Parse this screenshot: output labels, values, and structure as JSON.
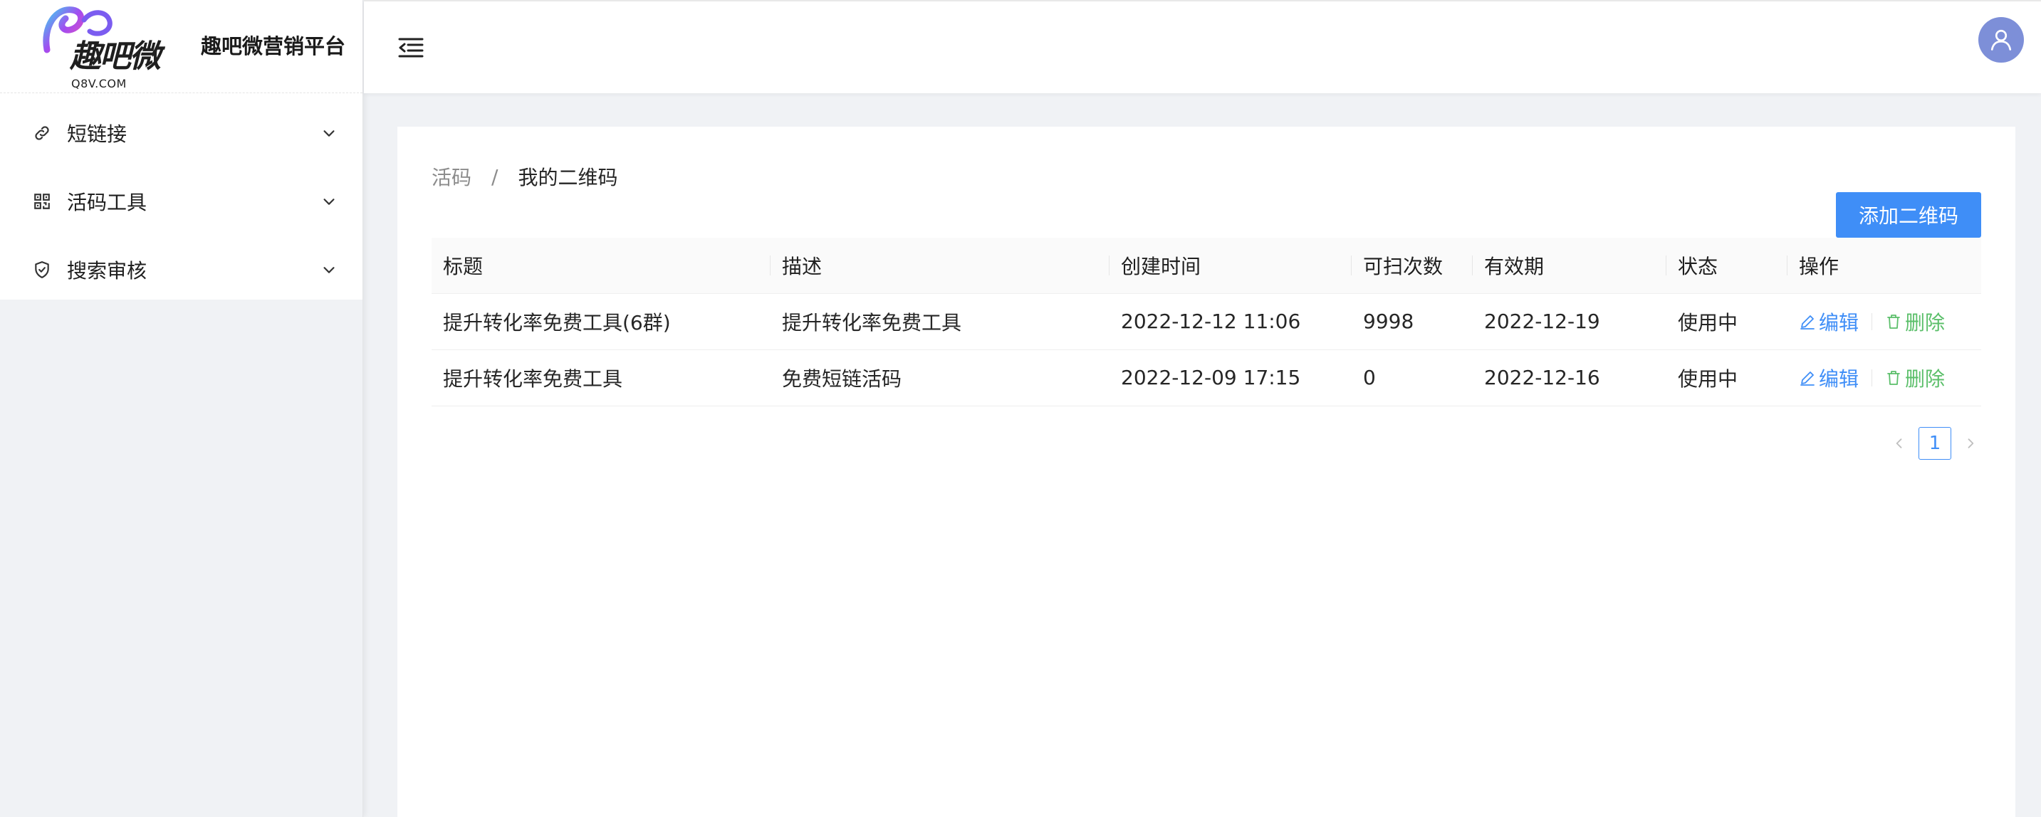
{
  "brand": {
    "logo_text": "趣吧微",
    "logo_sub": "Q8V.COM",
    "title": "趣吧微营销平台"
  },
  "sidebar": {
    "items": [
      {
        "label": "短链接",
        "icon": "link-icon"
      },
      {
        "label": "活码工具",
        "icon": "qrcode-icon"
      },
      {
        "label": "搜索审核",
        "icon": "shield-check-icon"
      }
    ]
  },
  "breadcrumb": {
    "parent": "活码",
    "separator": "/",
    "current": "我的二维码"
  },
  "toolbar": {
    "add_label": "添加二维码"
  },
  "table": {
    "columns": [
      "标题",
      "描述",
      "创建时间",
      "可扫次数",
      "有效期",
      "状态",
      "操作"
    ],
    "rows": [
      {
        "title": "提升转化率免费工具(6群)",
        "desc": "提升转化率免费工具",
        "created": "2022-12-12 11:06",
        "scans": "9998",
        "expiry": "2022-12-19",
        "status": "使用中",
        "edit": "编辑",
        "delete": "删除"
      },
      {
        "title": "提升转化率免费工具",
        "desc": "免费短链活码",
        "created": "2022-12-09 17:15",
        "scans": "0",
        "expiry": "2022-12-16",
        "status": "使用中",
        "edit": "编辑",
        "delete": "删除"
      }
    ]
  },
  "pagination": {
    "current_page": "1"
  },
  "colors": {
    "primary": "#3f8ef7",
    "delete": "#5bbf6a",
    "avatar": "#7d8fd8"
  }
}
